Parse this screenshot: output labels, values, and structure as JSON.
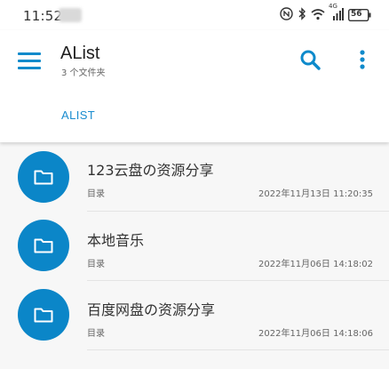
{
  "status_bar": {
    "time": "11:52",
    "icons": [
      "nfc-icon",
      "bluetooth-icon",
      "wifi-icon",
      "signal-icon",
      "battery-icon"
    ],
    "signal_label": "4G",
    "battery_level": "56"
  },
  "app_bar": {
    "title": "AList",
    "subtitle": "3 个文件夹",
    "tab_label": "ALIST",
    "accent_color": "#1a8ccf"
  },
  "files": [
    {
      "name": "123云盘の资源分享",
      "type": "目录",
      "date": "2022年11月13日 11:20:35",
      "icon": "folder-icon"
    },
    {
      "name": "本地音乐",
      "type": "目录",
      "date": "2022年11月06日 14:18:02",
      "icon": "folder-icon"
    },
    {
      "name": "百度网盘の资源分享",
      "type": "目录",
      "date": "2022年11月06日 14:18:06",
      "icon": "folder-icon"
    }
  ]
}
